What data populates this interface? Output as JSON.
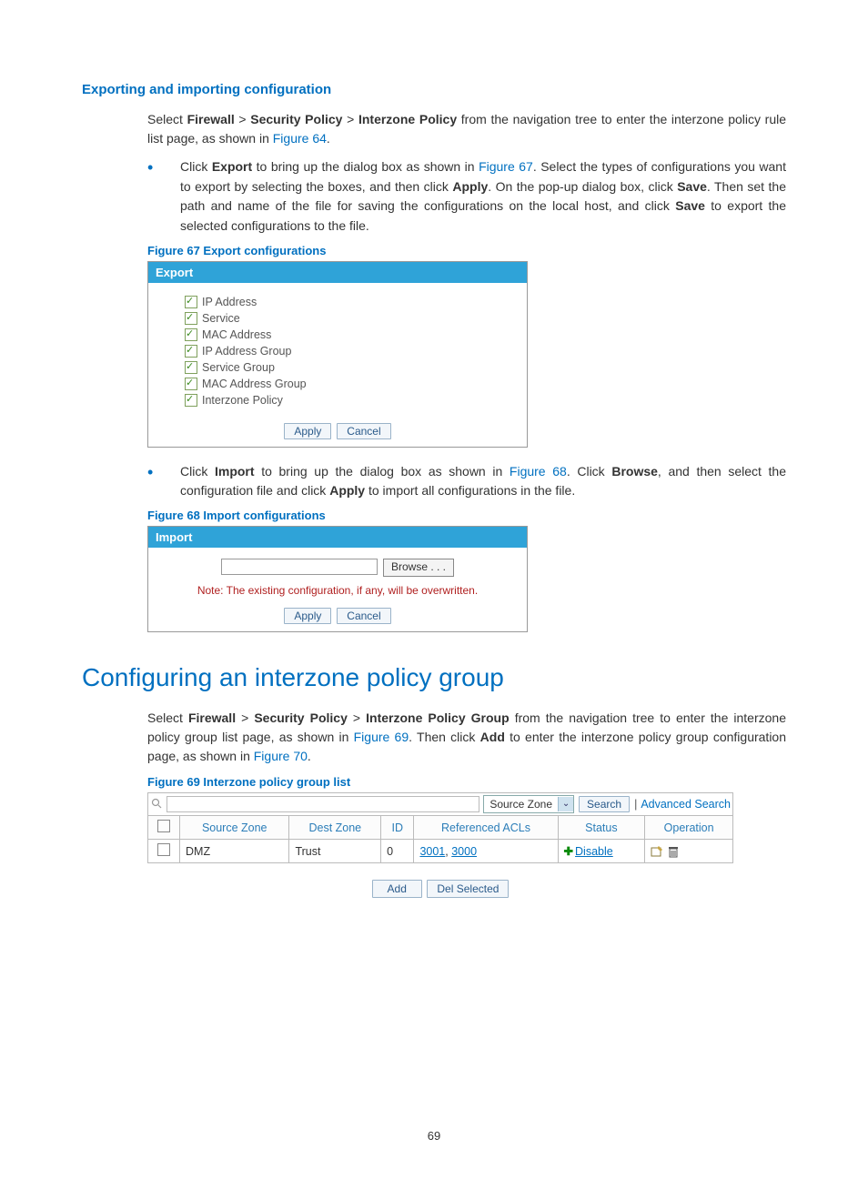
{
  "section1": {
    "heading": "Exporting and importing configuration",
    "intro_pre": "Select ",
    "intro_b1": "Firewall",
    "intro_gt1": " > ",
    "intro_b2": "Security Policy",
    "intro_gt2": " > ",
    "intro_b3": "Interzone Policy",
    "intro_post1": " from the navigation tree to enter the interzone policy rule list page, as shown in ",
    "intro_link1": "Figure 64",
    "intro_post2": ".",
    "bullet1_pre": "Click ",
    "bullet1_b1": "Export",
    "bullet1_mid1": " to bring up the dialog box as shown in ",
    "bullet1_link": "Figure 67",
    "bullet1_mid2": ". Select the types of configurations you want to export by selecting the boxes, and then click ",
    "bullet1_b2": "Apply",
    "bullet1_mid3": ". On the pop-up dialog box, click ",
    "bullet1_b3": "Save",
    "bullet1_mid4": ". Then set the path and name of the file for saving the configurations on the local host, and click ",
    "bullet1_b4": "Save",
    "bullet1_mid5": " to export the selected configurations to the file.",
    "fig67_caption": "Figure 67 Export configurations",
    "fig67": {
      "title": "Export",
      "items": [
        "IP Address",
        "Service",
        "MAC Address",
        "IP Address Group",
        "Service Group",
        "MAC Address Group",
        "Interzone Policy"
      ],
      "apply": "Apply",
      "cancel": "Cancel"
    },
    "bullet2_pre": "Click ",
    "bullet2_b1": "Import",
    "bullet2_mid1": " to bring up the dialog box as shown in ",
    "bullet2_link": "Figure 68",
    "bullet2_mid2": ". Click ",
    "bullet2_b2": "Browse",
    "bullet2_mid3": ", and then select the configuration file and click ",
    "bullet2_b3": "Apply",
    "bullet2_mid4": " to import all configurations in the file.",
    "fig68_caption": "Figure 68 Import configurations",
    "fig68": {
      "title": "Import",
      "browse": "Browse . . .",
      "note": "Note: The existing configuration, if any, will be overwritten.",
      "apply": "Apply",
      "cancel": "Cancel"
    }
  },
  "section2": {
    "heading": "Configuring an interzone policy group",
    "p_pre": "Select ",
    "p_b1": "Firewall",
    "p_gt1": " > ",
    "p_b2": "Security Policy",
    "p_gt2": " > ",
    "p_b3": "Interzone Policy Group",
    "p_mid1": " from the navigation tree to enter the interzone policy group list page, as shown in ",
    "p_link1": "Figure 69",
    "p_mid2": ". Then click ",
    "p_b4": "Add",
    "p_mid3": " to enter the interzone policy group configuration page, as shown in ",
    "p_link2": "Figure 70",
    "p_mid4": ".",
    "fig69_caption": "Figure 69 Interzone policy group list",
    "fig69": {
      "select_label": "Source Zone",
      "search_btn": "Search",
      "adv": "Advanced Search",
      "headers": [
        "Source Zone",
        "Dest Zone",
        "ID",
        "Referenced ACLs",
        "Status",
        "Operation"
      ],
      "row": {
        "src": "DMZ",
        "dst": "Trust",
        "id": "0",
        "acl1": "3001",
        "acl_sep": ", ",
        "acl2": "3000",
        "status": "Disable"
      },
      "add": "Add",
      "del": "Del Selected"
    }
  },
  "pagenum": "69"
}
